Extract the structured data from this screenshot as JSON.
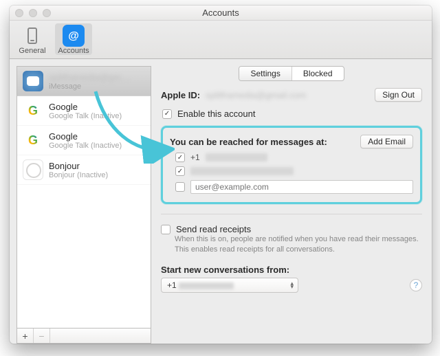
{
  "window": {
    "title": "Accounts"
  },
  "toolbar": {
    "general_label": "General",
    "accounts_label": "Accounts"
  },
  "sidebar": {
    "items": [
      {
        "name_redacted": "splitframedia@gmail",
        "sub": "iMessage",
        "icon": "imessage",
        "selected": true
      },
      {
        "name": "Google",
        "sub": "Google Talk (Inactive)",
        "icon": "google"
      },
      {
        "name": "Google",
        "sub": "Google Talk (Inactive)",
        "icon": "google"
      },
      {
        "name": "Bonjour",
        "sub": "Bonjour (Inactive)",
        "icon": "bonjour"
      }
    ],
    "add_label": "+",
    "remove_label": "−"
  },
  "tabs": {
    "settings": "Settings",
    "blocked": "Blocked",
    "selected": "Settings"
  },
  "apple_id": {
    "label": "Apple ID:",
    "value_redacted": "splitframedia@gmail.com",
    "signout": "Sign Out",
    "enable": "Enable this account",
    "enable_checked": true
  },
  "reach": {
    "heading": "You can be reached for messages at:",
    "add_email": "Add Email",
    "items": [
      {
        "checked": true,
        "text_redacted": "+1 (215) 620-0160"
      },
      {
        "checked": true,
        "text_redacted": "splitframedia@gmail.com"
      }
    ],
    "new_placeholder": "user@example.com"
  },
  "receipts": {
    "label": "Send read receipts",
    "hint": "When this is on, people are notified when you have read their messages. This enables read receipts for all conversations."
  },
  "start_from": {
    "label": "Start new conversations from:",
    "value_redacted": "+1 (215) 620-0160"
  },
  "help_tooltip": "?"
}
